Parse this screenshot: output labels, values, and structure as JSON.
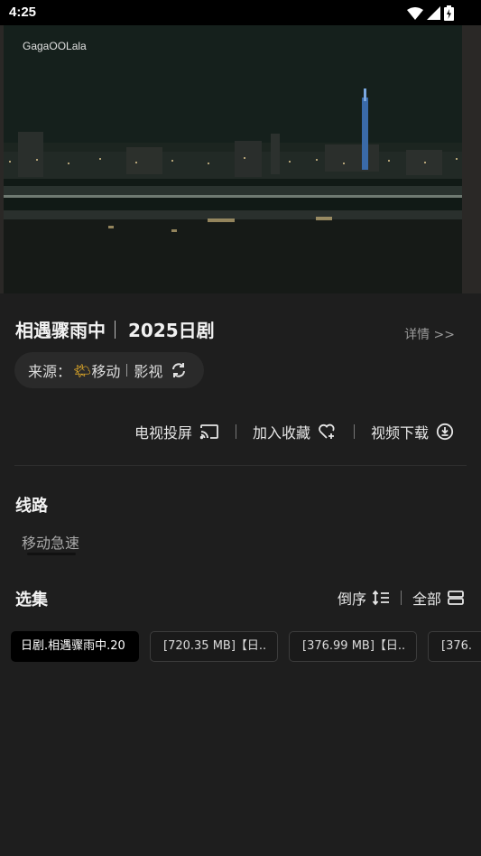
{
  "status_bar": {
    "time": "4:25"
  },
  "video": {
    "watermark": "GagaOOLala"
  },
  "show": {
    "title": "相遇骤雨中",
    "year_genre": "2025日剧",
    "details_link": "详情 >>"
  },
  "source": {
    "label": "来源：",
    "provider": "移动",
    "category": "影视"
  },
  "actions": {
    "cast": "电视投屏",
    "favorite": "加入收藏",
    "download": "视频下载"
  },
  "lines": {
    "title": "线路",
    "items": [
      {
        "label": "移动急速"
      }
    ]
  },
  "episodes": {
    "title": "选集",
    "sort_label": "倒序",
    "all_label": "全部",
    "items": [
      {
        "label": "日剧.相遇骤雨中.20"
      },
      {
        "label": "[720.35 MB]【日.."
      },
      {
        "label": "[376.99 MB]【日.."
      },
      {
        "label": "[376."
      }
    ]
  }
}
